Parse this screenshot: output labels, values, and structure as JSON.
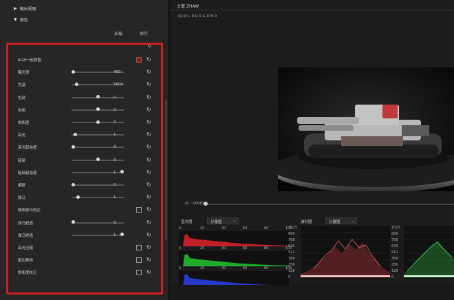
{
  "tree": {
    "items": [
      {
        "label": "输出视图",
        "expanded": false
      },
      {
        "label": "调色",
        "expanded": true
      }
    ]
  },
  "columns": {
    "add": "加载",
    "save": "保存"
  },
  "params": [
    {
      "label": "RGB一起调整",
      "type": "checkbox",
      "checked": true
    },
    {
      "label": "曝光度",
      "type": "slider",
      "fraction": 0.03,
      "value": "400"
    },
    {
      "label": "色温",
      "type": "slider",
      "fraction": 0.1,
      "value": "5600"
    },
    {
      "label": "色调",
      "type": "slider",
      "fraction": 0.5,
      "value": "0"
    },
    {
      "label": "色相",
      "type": "slider",
      "fraction": 0.5,
      "value": "0"
    },
    {
      "label": "饱和度",
      "type": "slider",
      "fraction": 0.5,
      "value": "0"
    },
    {
      "label": "高光",
      "type": "slider",
      "fraction": 0.07,
      "value": "1"
    },
    {
      "label": "高光起始值",
      "type": "slider",
      "fraction": 0.03,
      "value": "0"
    },
    {
      "label": "暗部",
      "type": "slider",
      "fraction": 0.5,
      "value": "0"
    },
    {
      "label": "暗部起始值",
      "type": "slider",
      "fraction": 0.97,
      "value": "1"
    },
    {
      "label": "偏移",
      "type": "slider",
      "fraction": 0.03,
      "value": "0"
    },
    {
      "label": "伽马",
      "type": "slider",
      "fraction": 0.13,
      "value": "1"
    },
    {
      "label": "使用伽马校正",
      "type": "checkbox",
      "checked": false
    },
    {
      "label": "伽马起值",
      "type": "slider",
      "fraction": 0.03,
      "value": "0"
    },
    {
      "label": "伽马终值",
      "type": "slider",
      "fraction": 0.97,
      "value": "1"
    },
    {
      "label": "高光压缩",
      "type": "checkbox",
      "checked": false
    },
    {
      "label": "紫边移除",
      "type": "checkbox",
      "checked": false
    },
    {
      "label": "饱和度校正",
      "type": "checkbox",
      "checked": false
    }
  ],
  "viewer": {
    "title": "主窗 ZHAW",
    "coords": "(0,0) L 0 R 0 G 0 B 0",
    "range_label": "(0 - 1000)"
  },
  "scopes": {
    "histogram_label": "直方图",
    "histogram_mode": "分量图",
    "waveform_label": "波形图",
    "waveform_mode": "分量图",
    "hist_ticks": [
      "0",
      "20",
      "40",
      "60",
      "80",
      "100"
    ],
    "wave_ticks": [
      "1023",
      "896",
      "768",
      "640",
      "512",
      "384",
      "256",
      "128",
      "0"
    ]
  },
  "colors": {
    "accent_red": "#d21e1e",
    "hist_red": "#c0202a",
    "hist_green": "#1faa2a",
    "hist_blue": "#2838c8"
  }
}
